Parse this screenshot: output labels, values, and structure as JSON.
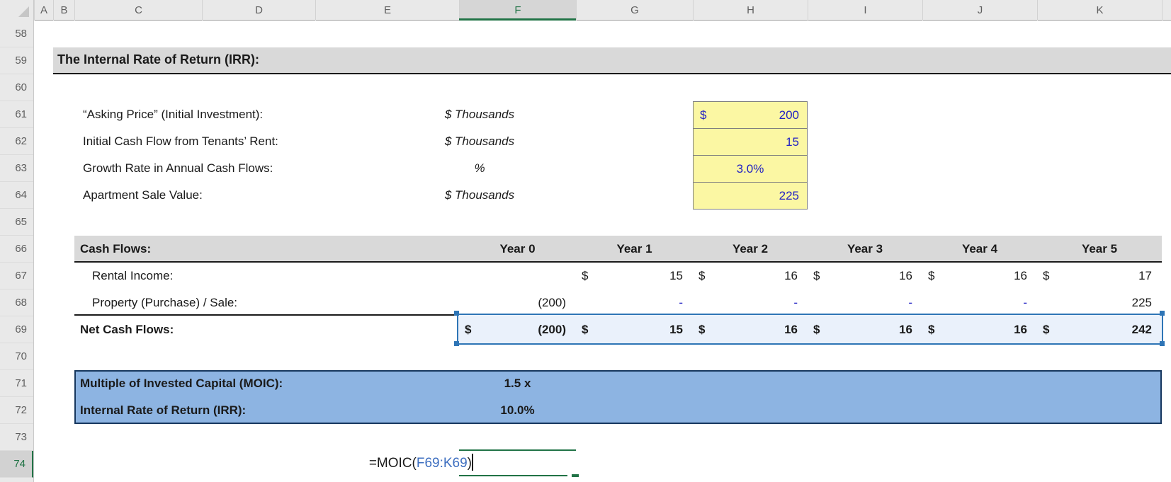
{
  "grid": {
    "columns": [
      "A",
      "B",
      "C",
      "D",
      "E",
      "F",
      "G",
      "H",
      "I",
      "J",
      "K"
    ],
    "rows": [
      "58",
      "59",
      "60",
      "61",
      "62",
      "63",
      "64",
      "65",
      "66",
      "67",
      "68",
      "69",
      "70",
      "71",
      "72",
      "73",
      "74"
    ],
    "selected_column": "F",
    "selected_row": "74"
  },
  "title": "The Internal Rate of Return (IRR):",
  "inputs": [
    {
      "label": "“Asking Price” (Initial Investment):",
      "unit": "$ Thousands",
      "currency": "$",
      "value": "200"
    },
    {
      "label": "Initial Cash Flow from Tenants’ Rent:",
      "unit": "$ Thousands",
      "currency": "",
      "value": "15"
    },
    {
      "label": "Growth Rate in Annual Cash Flows:",
      "unit": "%",
      "currency": "",
      "value": "3.0%"
    },
    {
      "label": "Apartment Sale Value:",
      "unit": "$ Thousands",
      "currency": "",
      "value": "225"
    }
  ],
  "cash_flows": {
    "label": "Cash Flows:",
    "years": [
      "Year 0",
      "Year 1",
      "Year 2",
      "Year 3",
      "Year 4",
      "Year 5"
    ],
    "rental": {
      "label": "Rental Income:",
      "cells": [
        {
          "cur": "",
          "val": ""
        },
        {
          "cur": "$",
          "val": "15"
        },
        {
          "cur": "$",
          "val": "16"
        },
        {
          "cur": "$",
          "val": "16"
        },
        {
          "cur": "$",
          "val": "16"
        },
        {
          "cur": "$",
          "val": "17"
        }
      ]
    },
    "property": {
      "label": "Property (Purchase) / Sale:",
      "cells": [
        {
          "cur": "",
          "val": "(200)"
        },
        {
          "cur": "",
          "val": "-"
        },
        {
          "cur": "",
          "val": "-"
        },
        {
          "cur": "",
          "val": "-"
        },
        {
          "cur": "",
          "val": "-"
        },
        {
          "cur": "",
          "val": "225"
        }
      ]
    },
    "net": {
      "label": "Net Cash Flows:",
      "cells": [
        {
          "cur": "$",
          "val": "(200)"
        },
        {
          "cur": "$",
          "val": "15"
        },
        {
          "cur": "$",
          "val": "16"
        },
        {
          "cur": "$",
          "val": "16"
        },
        {
          "cur": "$",
          "val": "16"
        },
        {
          "cur": "$",
          "val": "242"
        }
      ]
    }
  },
  "summary": [
    {
      "label": "Multiple of Invested Capital (MOIC):",
      "value": "1.5 x"
    },
    {
      "label": "Internal Rate of Return (IRR):",
      "value": "10.0%"
    }
  ],
  "formula": {
    "prefix": "=MOIC(",
    "reference": "F69:K69",
    "suffix": ")"
  },
  "colors": {
    "input_cell_fill": "#FBF7A3",
    "input_text_blue": "#2222C4",
    "summary_band_blue": "#8DB4E2",
    "selection_border_blue": "#2E75B6",
    "selection_fill": "#EAF1FB",
    "header_band_gray": "#D9D9D9",
    "excel_green": "#217346",
    "formula_reference_blue": "#3E6FC0"
  }
}
